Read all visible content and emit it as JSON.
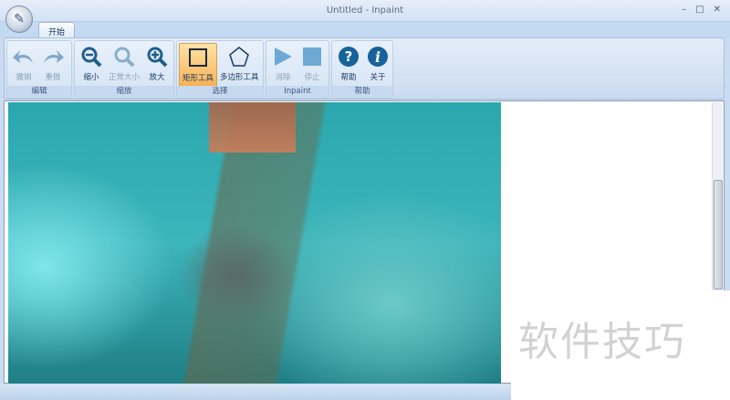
{
  "window": {
    "title": "Untitled - Inpaint",
    "minimize": "–",
    "maximize": "□",
    "close": "✕"
  },
  "tabs": [
    {
      "label": "开始"
    }
  ],
  "ribbon": {
    "groups": [
      {
        "label": "编辑",
        "buttons": [
          {
            "label": "撤销",
            "icon": "undo-icon"
          },
          {
            "label": "重做",
            "icon": "redo-icon"
          }
        ]
      },
      {
        "label": "缩放",
        "buttons": [
          {
            "label": "缩小",
            "icon": "zoom-out-icon"
          },
          {
            "label": "正常大小",
            "icon": "zoom-normal-icon"
          },
          {
            "label": "放大",
            "icon": "zoom-in-icon"
          }
        ]
      },
      {
        "label": "选择",
        "buttons": [
          {
            "label": "矩形工具",
            "icon": "rectangle-icon"
          },
          {
            "label": "多边形工具",
            "icon": "polygon-icon"
          }
        ]
      },
      {
        "label": "Inpaint",
        "buttons": [
          {
            "label": "消除",
            "icon": "play-icon"
          },
          {
            "label": "停止",
            "icon": "stop-icon"
          }
        ]
      },
      {
        "label": "帮助",
        "buttons": [
          {
            "label": "帮助",
            "icon": "help-icon"
          },
          {
            "label": "关于",
            "icon": "info-icon"
          }
        ]
      }
    ]
  },
  "watermark": "软件技巧"
}
